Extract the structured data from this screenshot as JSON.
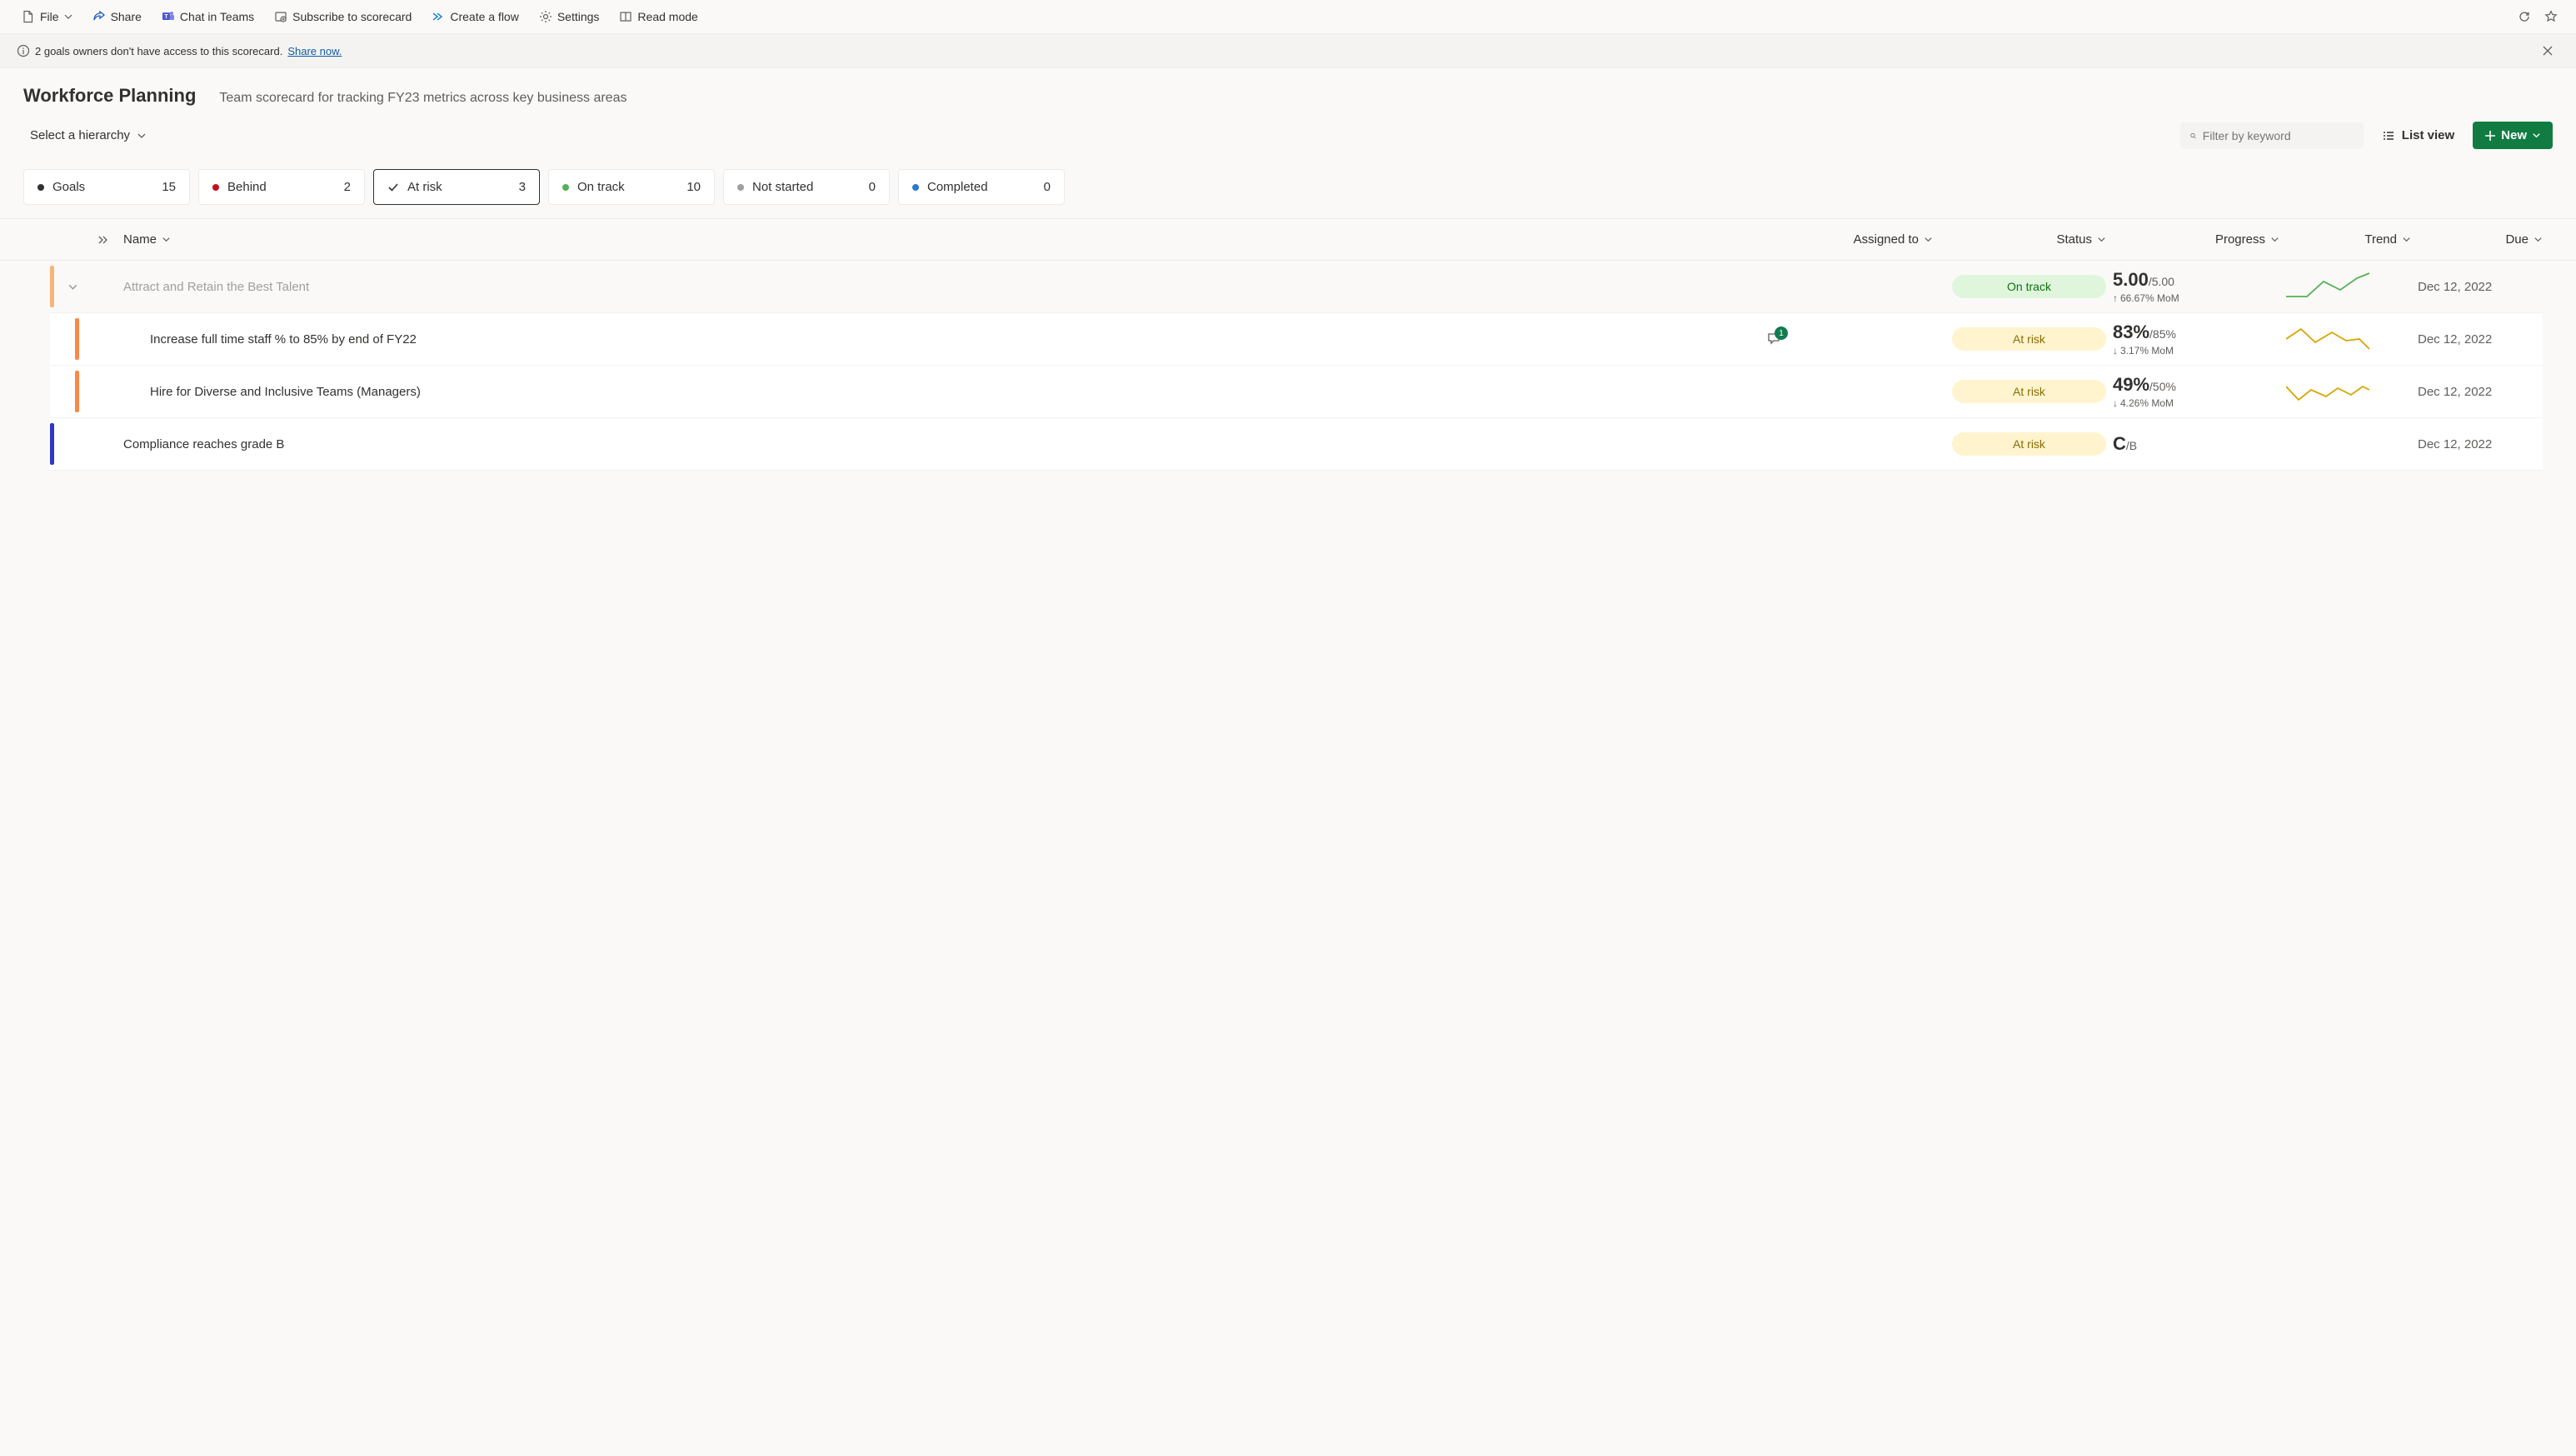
{
  "toolbar": {
    "file": "File",
    "share": "Share",
    "chat": "Chat in Teams",
    "subscribe": "Subscribe to scorecard",
    "flow": "Create a flow",
    "settings": "Settings",
    "readmode": "Read mode"
  },
  "notification": {
    "text": "2 goals owners don't have access to this scorecard.",
    "link": "Share now."
  },
  "header": {
    "title": "Workforce Planning",
    "subtitle": "Team scorecard for tracking FY23 metrics across key business areas",
    "hierarchy": "Select a hierarchy",
    "search_placeholder": "Filter by keyword",
    "listview": "List view",
    "new": "New"
  },
  "status_cards": [
    {
      "label": "Goals",
      "count": "15",
      "color": "#323130"
    },
    {
      "label": "Behind",
      "count": "2",
      "color": "#c50f1f"
    },
    {
      "label": "At risk",
      "count": "3",
      "color": "check",
      "active": true
    },
    {
      "label": "On track",
      "count": "10",
      "color": "#54b054"
    },
    {
      "label": "Not started",
      "count": "0",
      "color": "#a19f9d"
    },
    {
      "label": "Completed",
      "count": "0",
      "color": "#2878d0"
    }
  ],
  "columns": {
    "name": "Name",
    "assigned": "Assigned to",
    "status": "Status",
    "progress": "Progress",
    "trend": "Trend",
    "due": "Due"
  },
  "goals": [
    {
      "type": "parent",
      "bar": "#f4b57b",
      "name": "Attract and Retain the Best Talent",
      "status": "On track",
      "status_class": "pill-ontrack",
      "prog_main": "5.00",
      "prog_sub": "/5.00",
      "change_dir": "up",
      "change": "66.67% MoM",
      "trend": "green",
      "due": "Dec 12, 2022",
      "faded": true
    },
    {
      "type": "child",
      "bar": "#f7894a",
      "name": "Increase full time staff % to 85% by end of FY22",
      "comment": "1",
      "status": "At risk",
      "status_class": "pill-atrisk",
      "prog_main": "83%",
      "prog_sub": "/85%",
      "change_dir": "down",
      "change": "3.17% MoM",
      "trend": "yellow1",
      "due": "Dec 12, 2022"
    },
    {
      "type": "child",
      "bar": "#f7894a",
      "name": "Hire for Diverse and Inclusive Teams (Managers)",
      "status": "At risk",
      "status_class": "pill-atrisk",
      "prog_main": "49%",
      "prog_sub": "/50%",
      "change_dir": "down",
      "change": "4.26% MoM",
      "trend": "yellow2",
      "due": "Dec 12, 2022"
    },
    {
      "type": "top",
      "bar": "#2d39c5",
      "name": "Compliance reaches grade B",
      "status": "At risk",
      "status_class": "pill-atrisk",
      "prog_main": "C",
      "prog_sub": "/B",
      "due": "Dec 12, 2022"
    }
  ]
}
